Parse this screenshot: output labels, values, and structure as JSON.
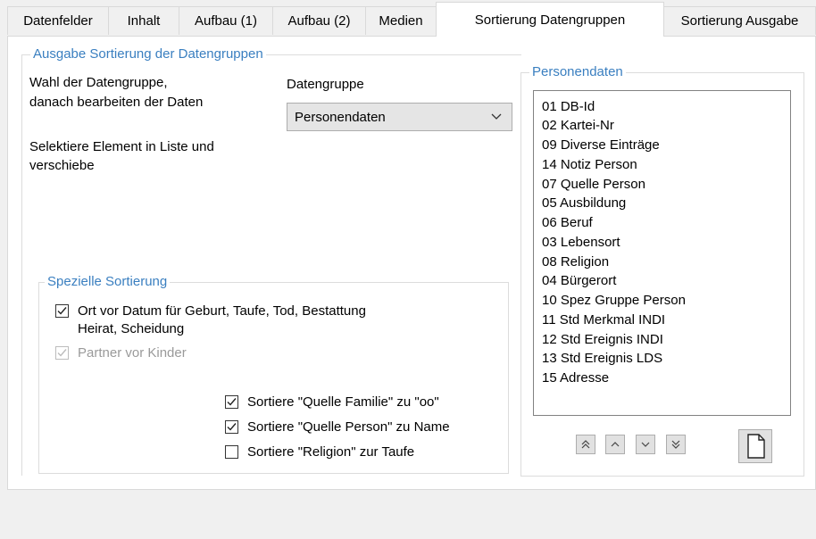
{
  "tabs": [
    {
      "label": "Datenfelder"
    },
    {
      "label": "Inhalt"
    },
    {
      "label": "Aufbau (1)"
    },
    {
      "label": "Aufbau (2)"
    },
    {
      "label": "Medien"
    },
    {
      "label": "Sortierung Datengruppen"
    },
    {
      "label": "Sortierung Ausgabe"
    }
  ],
  "active_tab": "Sortierung Datengruppen",
  "sort_group": {
    "title": "Ausgabe Sortierung der Datengruppen",
    "instruction_line1": "Wahl der Datengruppe,",
    "instruction_line2": "danach bearbeiten der Daten",
    "select_hint_line1": "Selektiere Element in Liste und",
    "select_hint_line2": "verschiebe",
    "datengruppe_label": "Datengruppe",
    "datengruppe_value": "Personendaten"
  },
  "special_sort": {
    "title": "Spezielle Sortierung",
    "ort_vor_datum_line1": "Ort vor Datum für Geburt, Taufe, Tod, Bestattung",
    "ort_vor_datum_line2": "Heirat, Scheidung",
    "ort_vor_datum_checked": true,
    "partner_vor_kinder": "Partner vor Kinder",
    "partner_vor_kinder_checked": true,
    "partner_vor_kinder_enabled": false,
    "quelle_familie": "Sortiere \"Quelle Familie\" zu \"oo\"",
    "quelle_familie_checked": true,
    "quelle_person": "Sortiere \"Quelle Person\" zu Name",
    "quelle_person_checked": true,
    "religion_taufe": "Sortiere \"Religion\" zur Taufe",
    "religion_taufe_checked": false
  },
  "personendaten": {
    "title": "Personendaten",
    "items": [
      "01 DB-Id",
      "02 Kartei-Nr",
      "09 Diverse Einträge",
      "14 Notiz Person",
      "07 Quelle Person",
      "05 Ausbildung",
      "06 Beruf",
      "03 Lebensort",
      "08 Religion",
      "04 Bürgerort",
      "10 Spez Gruppe Person",
      "11 Std Merkmal INDI",
      "12 Std Ereignis INDI",
      "13 Std Ereignis LDS",
      "15 Adresse"
    ]
  },
  "icons": {
    "move_top": "double-chevron-up-icon",
    "move_up": "chevron-up-icon",
    "move_down": "chevron-down-icon",
    "move_bottom": "double-chevron-down-icon",
    "new_page": "page-icon",
    "dropdown": "chevron-down-icon",
    "checkmark": "checkmark-icon"
  },
  "colors": {
    "group_title": "#3a7fc0",
    "tab_active_bg": "#ffffff",
    "window_bg": "#f0f0f0"
  }
}
